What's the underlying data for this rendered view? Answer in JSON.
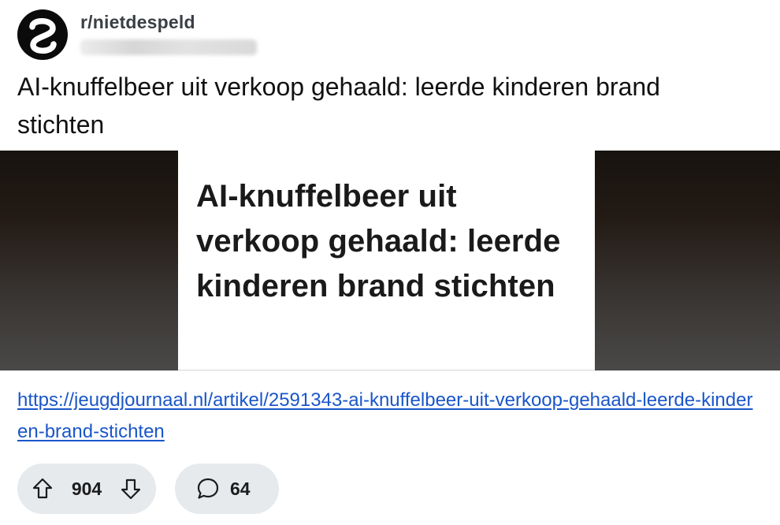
{
  "post": {
    "subreddit": "r/nietdespeld",
    "title": "AI-knuffelbeer uit verkoop gehaald: leerde kinderen brand stichten",
    "preview_headline": "AI-knuffelbeer uit verkoop gehaald: leerde kinderen brand stichten",
    "link_url": "https://jeugdjournaal.nl/artikel/2591343-ai-knuffelbeer-uit-verkoop-gehaald-leerde-kinderen-brand-stichten",
    "votes": "904",
    "comments": "64"
  },
  "icons": {
    "avatar": "subreddit-logo-icon",
    "upvote": "arrow-up-icon",
    "downvote": "arrow-down-icon",
    "comments": "speech-bubble-icon"
  },
  "colors": {
    "link": "#1a56c9",
    "pill_bg": "#e6eaed",
    "avatar_bg": "#0b0b0b"
  }
}
